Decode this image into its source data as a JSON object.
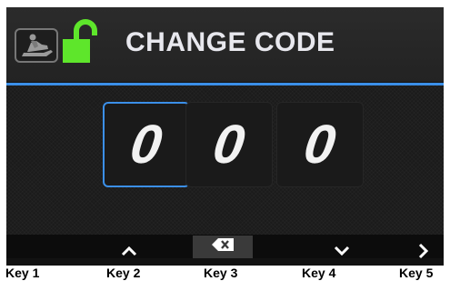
{
  "header": {
    "title": "CHANGE CODE",
    "icons": [
      "snowmobile-icon",
      "unlocked-padlock-icon"
    ]
  },
  "code": {
    "digits": [
      "0",
      "0",
      "0"
    ],
    "selected_index": 0
  },
  "softkeys": {
    "icons": [
      "chevron-up-icon",
      "backspace-icon",
      "chevron-down-icon",
      "chevron-right-icon"
    ]
  },
  "key_labels": [
    "Key 1",
    "Key 2",
    "Key 3",
    "Key 4",
    "Key 5"
  ],
  "colors": {
    "accent": "#3b8fe8",
    "lock_green": "#5ee62b",
    "title_text": "#e8e8ee",
    "background": "#121212"
  }
}
